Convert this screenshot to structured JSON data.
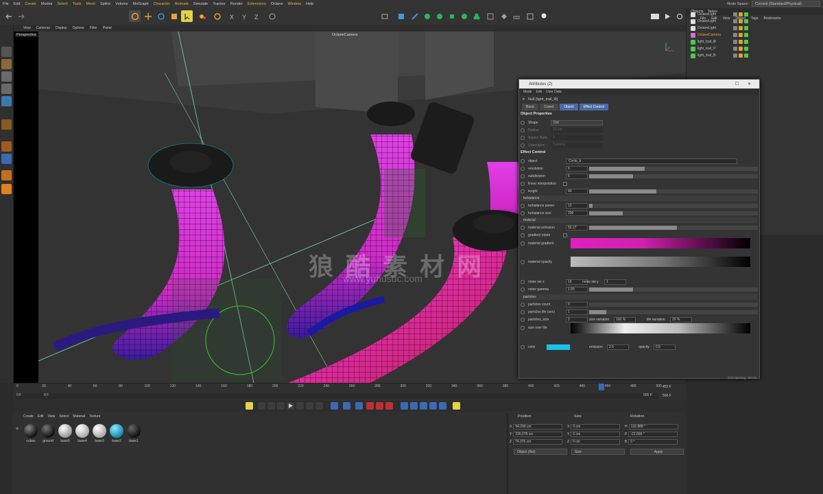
{
  "menubar": {
    "items": [
      "File",
      "Edit",
      "Create",
      "Modes",
      "Select",
      "Tools",
      "Mesh",
      "Spline",
      "Volume",
      "MoGraph",
      "Character",
      "Animate",
      "Simulate",
      "Tracker",
      "Render",
      "Extensions",
      "Octane",
      "Window",
      "Help"
    ],
    "node_space_label": "Node Space:",
    "node_space_value": "Current (Standard/Physical)"
  },
  "viewport": {
    "menu": [
      "View",
      "Cameras",
      "Display",
      "Options",
      "Filter",
      "Panel"
    ],
    "label": "Perspective",
    "camera": "OctaneCamera",
    "grid_spacing": "Grid Spacing : 50 cm"
  },
  "objects": {
    "tabs": [
      "Objects",
      "Takes"
    ],
    "menu": [
      "File",
      "Edit",
      "View",
      "Object",
      "Tags",
      "Bookmarks"
    ],
    "rows": [
      "OctaneLight",
      "OctaneLight",
      "OctaneLight",
      "OctaneCamera",
      "light_trail_l8",
      "light_trail_l7",
      "light_trail_l6"
    ]
  },
  "attributes": {
    "title": "Attributes (2)",
    "menu": [
      "Mode",
      "Edit",
      "User Data"
    ],
    "object_name": "Null [light_trail_l8]",
    "tabs": [
      "Basic",
      "Coord.",
      "Object",
      "Effect Control"
    ],
    "object_properties": "Object Properties",
    "shape_label": "Shape",
    "shape_value": "Dot",
    "radius_label": "Radius",
    "radius_value": "10 cm",
    "aspect_label": "Aspect Ratio",
    "aspect_value": "1",
    "orient_label": "Orientation",
    "orient_value": "Camera",
    "effect_control": "Effect Control",
    "object_label": "object",
    "object_value": "Circle_b",
    "resolution_label": "resolution",
    "resolution_value": "6",
    "subdivision_label": "subdivision",
    "subdivision_value": "6",
    "linear_label": "linear interpolation",
    "lenght_label": "lenght",
    "lenght_value": "40",
    "turbulance": "turbulance",
    "tpower_label": "turbulance power",
    "tpower_value": "10",
    "tsize_label": "turbulance size",
    "tsize_value": "200",
    "material": "material",
    "memission_label": "material emission",
    "memission_value": "52.27",
    "grotate_label": "gradient rotate",
    "mgradient_label": "material gradient",
    "mopacity_label": "material opacity",
    "noisex_label": "noise sie x",
    "noisex_value": "10",
    "noisey_label": "noise sie y",
    "noisey_value": "1",
    "ngamma_label": "noise gamma",
    "ngamma_value": "1.55",
    "particles": "particles",
    "pcount_label": "particles count",
    "pcount_value": "0",
    "plife_label": "particles life (sec)",
    "plife_value": "1",
    "psize_label": "particles_size",
    "psize_value": "2",
    "svar_label": "size variation",
    "svar_value": "100 %",
    "lvar_label": "life variation",
    "lvar_value": "20 %",
    "sol_label": "size over life",
    "color_label": "color",
    "emission_label": "emission",
    "emission_value": "2.5",
    "opacity_label": "opacity",
    "opacity_value": "0.5",
    "accent_color": "#4b6aa5",
    "particle_color": "#17c3ea"
  },
  "timeline": {
    "ticks": [
      "0",
      "20",
      "40",
      "60",
      "80",
      "100",
      "120",
      "140",
      "160",
      "180",
      "200",
      "220",
      "240",
      "260",
      "280",
      "300",
      "320",
      "340",
      "360",
      "380",
      "400",
      "420",
      "440",
      "460",
      "480",
      "500"
    ],
    "current": "453 F",
    "start": "0 F",
    "start2": "0 F",
    "end": "500 F",
    "end2": "500 F"
  },
  "materials": {
    "menu": [
      "Create",
      "Edit",
      "View",
      "Select",
      "Material",
      "Texture"
    ],
    "items": [
      "cubes",
      "ground",
      "base5",
      "base4",
      "base3",
      "base2",
      "base1"
    ]
  },
  "coords": {
    "position": "Position",
    "size": "Size",
    "rotation": "Rotation",
    "px": "54.206 cm",
    "py": "235.078 cm",
    "pz": "74.376 cm",
    "sx": "0 cm",
    "sy": "0 cm",
    "sz": "0 cm",
    "rh": "132.888 °",
    "rp": "-22.669 °",
    "rb": "0 °",
    "mode": "Object (Rel)",
    "size_mode": "Size",
    "apply": "Apply"
  },
  "watermark": {
    "cn": "狼 酷 素 材 网",
    "url": "www.yuhusuc.com"
  }
}
